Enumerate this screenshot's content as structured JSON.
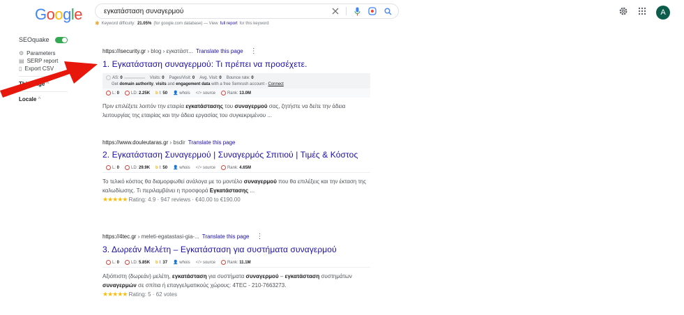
{
  "logo": [
    "G",
    "o",
    "o",
    "g",
    "l",
    "e"
  ],
  "logo_colors": [
    "#4285f4",
    "#ea4335",
    "#fbbc05",
    "#4285f4",
    "#34a853",
    "#ea4335"
  ],
  "search": {
    "query": "εγκατάσταση συναγερμού"
  },
  "keyword_bar": {
    "prefix": "Keyword difficulty:",
    "value": "21.05%",
    "middle": "(for google.com database) — View",
    "link": "full report",
    "suffix": "for this keyword"
  },
  "account": {
    "initial": "A",
    "color": "#0b5c4a"
  },
  "seoquake": {
    "title": "SEOquake",
    "items": [
      "Parameters",
      "SERP report",
      "Export CSV"
    ],
    "section1": "This page",
    "section2": "Locale"
  },
  "results": [
    {
      "domain": "https://isecurity.gr",
      "path": "› blog › εγκατάστ...",
      "translate": "Translate this page",
      "title": "1. Εγκατάσταση συναγερμού: Τι πρέπει να προσέχετε.",
      "semrush": {
        "as_label": "AS:",
        "as_value": "0",
        "visits_label": "Visits:",
        "visits": "0",
        "pages_label": "Pages/Visit:",
        "pages": "0",
        "avg_label": "Avg. Visit:",
        "avg": "0",
        "bounce_label": "Bounce rate:",
        "bounce": "0",
        "get": "Get",
        "get_b1": "domain authority",
        "get_mid": ",",
        "get_b2": "visits",
        "get_and": "and",
        "get_b3": "engagement data",
        "get_rest": "with a free Semrush account -",
        "connect": "Connect"
      },
      "stats": {
        "l": "0",
        "ld": "2.25K",
        "i": "50",
        "whois": "whois",
        "source": "source",
        "rank": "13.0M"
      },
      "snippet": [
        {
          "t": "Πριν επιλέξετε λοιπόν την εταιρία "
        },
        {
          "b": "εγκατάστασης"
        },
        {
          "t": " του "
        },
        {
          "b": "συναγερμού"
        },
        {
          "t": " σας, ζητήστε να δείτε την άδεια λειτουργίας της εταιρίας και την άδεια εργασίας του συγκεκριμένου ..."
        }
      ]
    },
    {
      "domain": "https://www.douleutaras.gr",
      "path": "› bsdir",
      "translate": "Translate this page",
      "title": "2. Εγκατάσταση Συναγερμού | Συναγερμός Σπιτιού | Τιμές & Κόστος",
      "stats": {
        "l": "0",
        "ld": "29.9K",
        "i": "50",
        "whois": "whois",
        "source": "source",
        "rank": "4.65M"
      },
      "snippet": [
        {
          "t": "Το τελικό κόστος θα διαμορφωθεί ανάλογα με το μοντέλο "
        },
        {
          "b": "συναγερμού"
        },
        {
          "t": " που θα επιλέξεις και την έκταση της καλωδίωσης. Τι περιλαμβάνει η προσφορά "
        },
        {
          "b": "Εγκατάστασης"
        },
        {
          "t": " ..."
        }
      ],
      "stars": "★★★★★",
      "rating": "Rating: 4.9 · 947 reviews · €40.00 to €190.00"
    },
    {
      "domain": "https://4tec.gr",
      "path": "› meleti-egatastasi-gia-...",
      "translate": "Translate this page",
      "title": "3. Δωρεάν Μελέτη – Εγκατάσταση για συστήματα συναγερμού",
      "stats": {
        "l": "0",
        "ld": "5.85K",
        "i": "37",
        "whois": "whois",
        "source": "source",
        "rank": "11.1M"
      },
      "snippet": [
        {
          "t": "Αξιόπιστη (δωρεάν) μελέτη, "
        },
        {
          "b": "εγκατάσταση"
        },
        {
          "t": " για συστήματα "
        },
        {
          "b": "συναγερμού"
        },
        {
          "t": " – "
        },
        {
          "b": "εγκατάσταση"
        },
        {
          "t": " συστημάτων "
        },
        {
          "b": "συναγερμών"
        },
        {
          "t": " σε σπίτια ή επαγγελματικούς χώρους: 4TEC - 210-7663273."
        }
      ],
      "stars": "★★★★★",
      "rating": "Rating: 5 · 62 votes"
    }
  ]
}
